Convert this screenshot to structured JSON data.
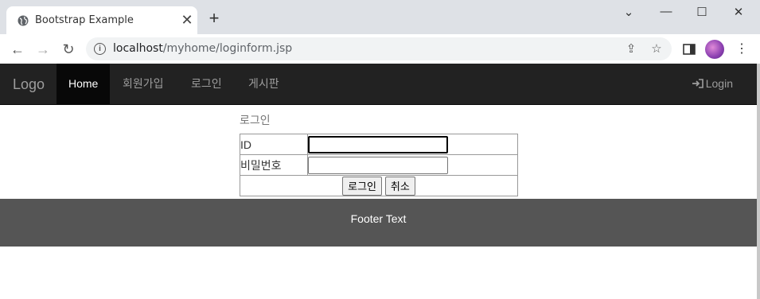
{
  "browser": {
    "tab_title": "Bootstrap Example",
    "tab_close": "✕",
    "new_tab": "+",
    "url_host": "localhost",
    "url_path": "/myhome/loginform.jsp",
    "window_controls": {
      "minimize": "—",
      "maximize": "☐",
      "close": "✕",
      "dropdown": "⌄"
    },
    "back": "←",
    "forward": "→",
    "reload": "↻",
    "share": "⇪",
    "star": "☆",
    "menu": "⋮"
  },
  "navbar": {
    "brand": "Logo",
    "items": [
      {
        "label": "Home",
        "active": true
      },
      {
        "label": "회원가입",
        "active": false
      },
      {
        "label": "로그인",
        "active": false
      },
      {
        "label": "게시판",
        "active": false
      }
    ],
    "login_label": "Login"
  },
  "form": {
    "heading": "로그인",
    "id_label": "ID",
    "id_value": "",
    "pw_label": "비밀번호",
    "pw_value": "",
    "submit_label": "로그인",
    "cancel_label": "취소"
  },
  "footer": {
    "text": "Footer Text"
  }
}
